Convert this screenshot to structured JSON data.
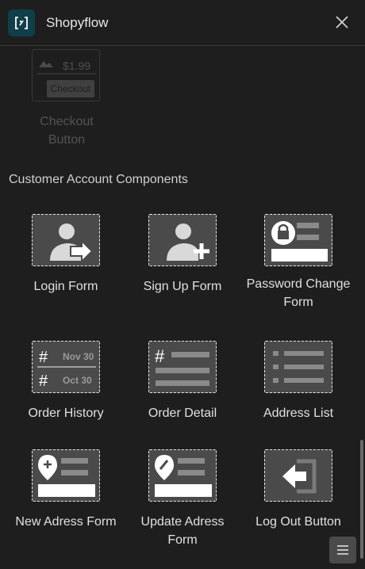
{
  "header": {
    "title": "Shopyflow",
    "logo_icon": "shopyflow-logo-icon",
    "close_icon": "close-icon"
  },
  "faded_component": {
    "price": "$1.99",
    "button_label": "Checkout",
    "label": "Checkout Button"
  },
  "section": {
    "title": "Customer Account Components"
  },
  "components": [
    {
      "label": "Login Form",
      "icon": "login-form-icon"
    },
    {
      "label": "Sign Up Form",
      "icon": "sign-up-form-icon"
    },
    {
      "label": "Password Change Form",
      "icon": "password-change-form-icon"
    },
    {
      "label": "Order History",
      "icon": "order-history-icon",
      "dates": [
        "Nov 30",
        "Oct 30"
      ]
    },
    {
      "label": "Order Detail",
      "icon": "order-detail-icon"
    },
    {
      "label": "Address List",
      "icon": "address-list-icon"
    },
    {
      "label": "New Adress Form",
      "icon": "new-address-form-icon"
    },
    {
      "label": "Update Adress Form",
      "icon": "update-address-form-icon"
    },
    {
      "label": "Log Out Button",
      "icon": "log-out-button-icon"
    }
  ],
  "footer": {
    "menu_icon": "menu-icon"
  }
}
